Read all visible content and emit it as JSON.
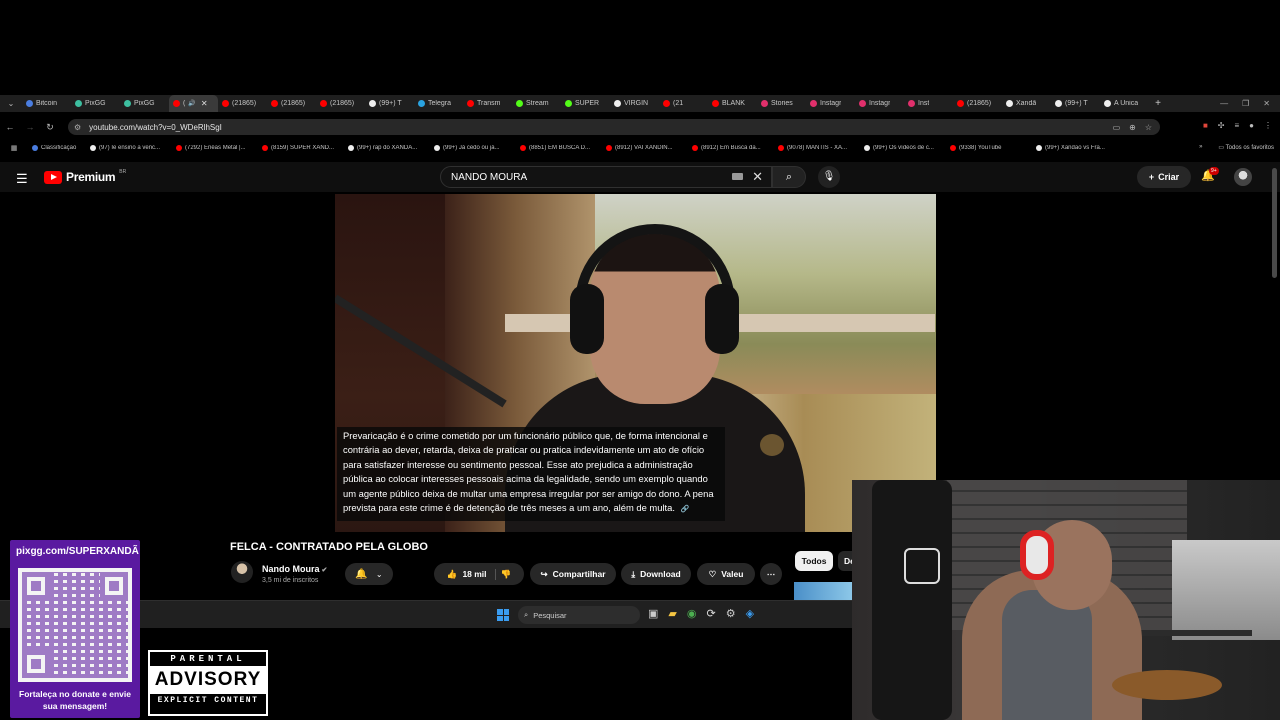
{
  "browser": {
    "tabs": [
      {
        "label": "Bitcoin",
        "color": "#4a7de0"
      },
      {
        "label": "PixGG",
        "color": "#3dbfa0"
      },
      {
        "label": "PixGG",
        "color": "#3dbfa0"
      },
      {
        "label": "(",
        "color": "#ff0000",
        "active": true
      },
      {
        "label": "(21865)",
        "color": "#ff0000"
      },
      {
        "label": "(21865)",
        "color": "#ff0000"
      },
      {
        "label": "(21865)",
        "color": "#ff0000"
      },
      {
        "label": "(99+) T",
        "color": "#eeeeee"
      },
      {
        "label": "Telegra",
        "color": "#2aa3e0"
      },
      {
        "label": "Transm",
        "color": "#ff0000"
      },
      {
        "label": "Stream",
        "color": "#53fc18"
      },
      {
        "label": "SUPER",
        "color": "#53fc18"
      },
      {
        "label": "VIRGIN",
        "color": "#eeeeee"
      },
      {
        "label": "(21",
        "color": "#ff0000"
      },
      {
        "label": "BLANK",
        "color": "#ff0000"
      },
      {
        "label": "Stories",
        "color": "#e1306c"
      },
      {
        "label": "Instagr",
        "color": "#e1306c"
      },
      {
        "label": "Instagr",
        "color": "#e1306c"
      },
      {
        "label": "Inst",
        "color": "#e1306c"
      },
      {
        "label": "(21865)",
        "color": "#ff0000"
      },
      {
        "label": "Xandã",
        "color": "#eeeeee"
      },
      {
        "label": "(99+) T",
        "color": "#eeeeee"
      },
      {
        "label": "A Única",
        "color": "#eeeeee"
      }
    ],
    "url": "youtube.com/watch?v=0_WDeRlhSgI",
    "bookmarks": [
      {
        "label": "Classificação",
        "color": "#4a7de0"
      },
      {
        "label": "(97) Ie ensino a venc...",
        "color": "#eeeeee"
      },
      {
        "label": "(7292) Enéas Metal |...",
        "color": "#ff0000"
      },
      {
        "label": "(8159) SUPER XAND...",
        "color": "#ff0000"
      },
      {
        "label": "(99+) rap do XANDÃ...",
        "color": "#eeeeee"
      },
      {
        "label": "(99+) Já cedo ou já...",
        "color": "#eeeeee"
      },
      {
        "label": "(8851) EM BUSCA D...",
        "color": "#ff0000"
      },
      {
        "label": "(8912) VAI XANDIN...",
        "color": "#ff0000"
      },
      {
        "label": "(8912) Em Busca da...",
        "color": "#ff0000"
      },
      {
        "label": "(9078) MANTIS - XA...",
        "color": "#ff0000"
      },
      {
        "label": "(99+) Os vídeos de c...",
        "color": "#eeeeee"
      },
      {
        "label": "(9338) YouTube",
        "color": "#ff0000"
      },
      {
        "label": "(99+) Xandão vs Fra...",
        "color": "#eeeeee"
      }
    ],
    "bookmarks_more": "»",
    "all_favorites": "Todos os favoritos"
  },
  "youtube": {
    "brand": "Premium",
    "country": "BR",
    "search_value": "NANDO MOURA",
    "create_label": "Criar",
    "notif_count": "9+",
    "subtitle_text": "Prevaricação é o crime cometido por um funcionário público que, de forma intencional e contrária ao dever, retarda, deixa de praticar ou pratica indevidamente um ato de ofício para satisfazer interesse ou sentimento pessoal. Esse ato prejudica a administração pública ao colocar interesses pessoais acima da legalidade, sendo um exemplo quando um agente público deixa de multar uma empresa irregular por ser amigo do dono. A pena prevista para este crime é de detenção de três meses a um ano, além de multa.",
    "video_title": "FELCA - CONTRATADO PELA GLOBO",
    "channel_name": "Nando Moura",
    "subscribers": "3,5 mi de inscritos",
    "likes": "18 mil",
    "share_label": "Compartilhar",
    "download_label": "Download",
    "thanks_label": "Valeu",
    "chip_all": "Todos",
    "chip_next": "De"
  },
  "taskbar": {
    "search_placeholder": "Pesquisar"
  },
  "overlay": {
    "donate_url": "pixgg.com/SUPERXANDÃ",
    "donate_text": "Fortaleça no donate e envie sua mensagem!",
    "advisory_top": "PARENTAL",
    "advisory_mid": "ADVISORY",
    "advisory_bot": "EXPLICIT CONTENT"
  }
}
